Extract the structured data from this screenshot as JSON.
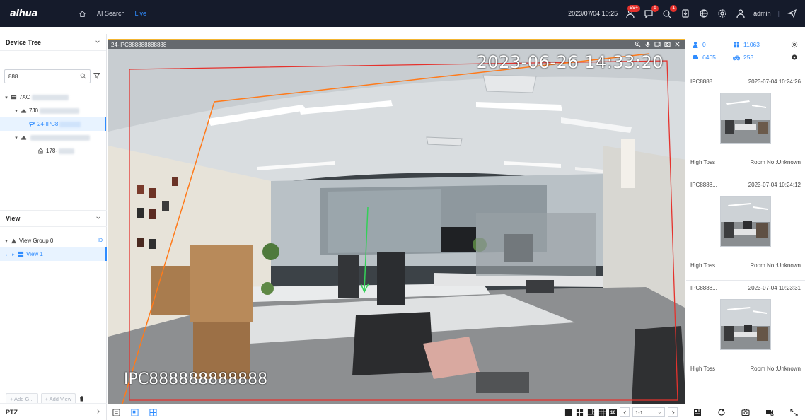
{
  "brand": {
    "logo_text": "alhua"
  },
  "topnav": {
    "items": [
      {
        "label": "AI Search",
        "active": false
      },
      {
        "label": "Live",
        "active": true
      }
    ],
    "datetime": "2023/07/04 10:25",
    "badges": {
      "alarm": "99+",
      "message": "5",
      "event": "1"
    },
    "user": "admin"
  },
  "left": {
    "device_tree_title": "Device Tree",
    "search_value": "888",
    "tree": [
      {
        "label": "7AC",
        "level": 0,
        "selected": false
      },
      {
        "label": "7J0",
        "level": 1,
        "selected": false
      },
      {
        "label": "24-IPC8",
        "level": 2,
        "selected": true
      },
      {
        "label": "",
        "level": 1,
        "selected": false
      },
      {
        "label": "178-",
        "level": 2,
        "selected": false
      }
    ],
    "view_title": "View",
    "view_tree": [
      {
        "label": "View Group 0",
        "selected": false
      },
      {
        "label": "View 1",
        "selected": true
      }
    ],
    "add_group_label": "+ Add G...",
    "add_view_label": "+ Add View",
    "ptz_label": "PTZ"
  },
  "video": {
    "title": "24-IPC888888888888",
    "osd_time": "2023-06-26 14:33:20",
    "osd_name": "IPC888888888888"
  },
  "stats": {
    "person": "0",
    "people_group": "11063",
    "car": "6465",
    "bike": "253"
  },
  "events": [
    {
      "source": "IPC8888...",
      "time": "2023-07-04 10:24:26",
      "type": "High Toss",
      "room": "Room No.:Unknown"
    },
    {
      "source": "IPC8888...",
      "time": "2023-07-04 10:24:12",
      "type": "High Toss",
      "room": "Room No.:Unknown"
    },
    {
      "source": "IPC8888...",
      "time": "2023-07-04 10:23:31",
      "type": "High Toss",
      "room": "Room No.:Unknown"
    }
  ],
  "bottombar": {
    "page": "1-1",
    "layout16_label": "16"
  },
  "colors": {
    "accent": "#2f8cff",
    "topbar": "#151b2b",
    "selection_border": "#f3b531",
    "alarm_line": "#e5322d",
    "tripwire": "#ff7a1a"
  }
}
